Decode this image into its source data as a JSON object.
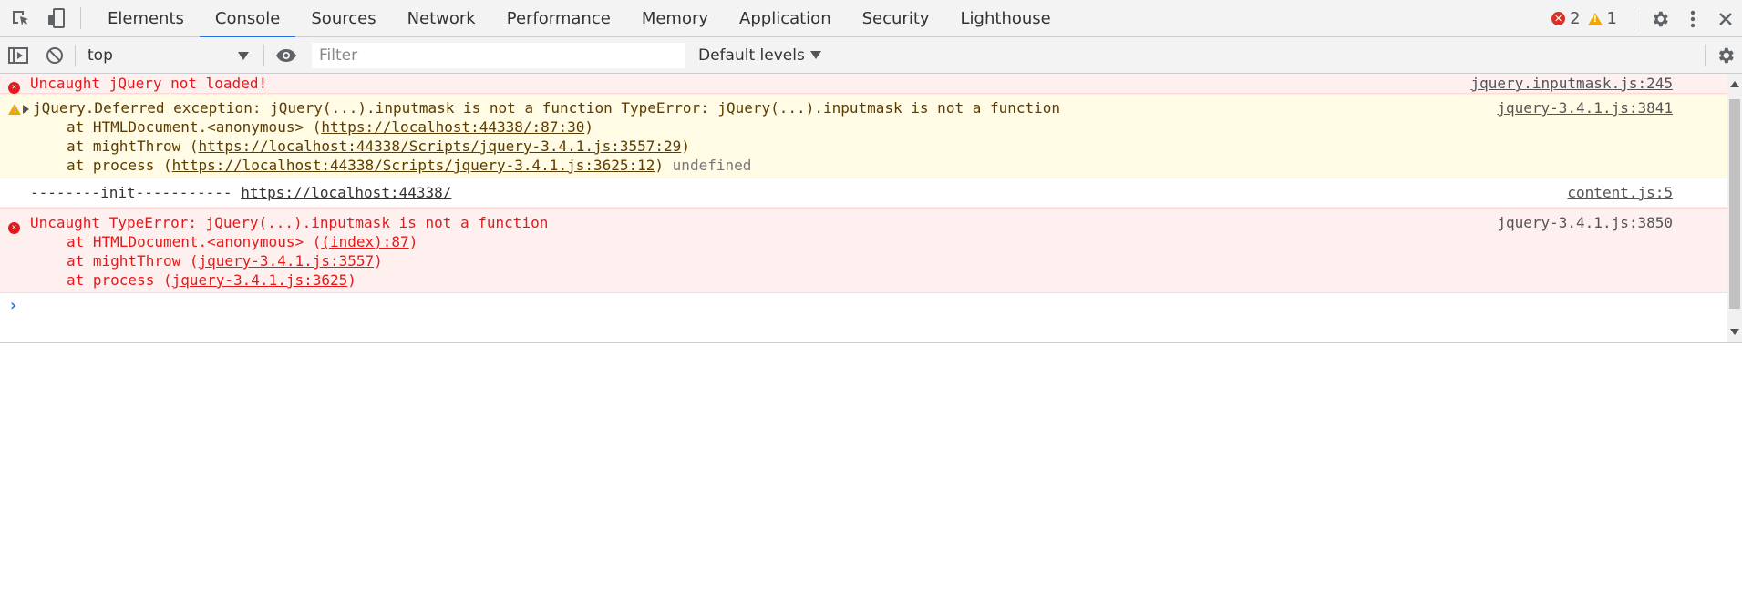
{
  "tabs": [
    "Elements",
    "Console",
    "Sources",
    "Network",
    "Performance",
    "Memory",
    "Application",
    "Security",
    "Lighthouse"
  ],
  "active_tab": "Console",
  "counters": {
    "errors": "2",
    "warnings": "1"
  },
  "toolbar": {
    "context": "top",
    "filter_placeholder": "Filter",
    "levels": "Default levels"
  },
  "messages": [
    {
      "level": "error",
      "text": "Uncaught jQuery not loaded!",
      "source": "jquery.inputmask.js:245"
    },
    {
      "level": "warning",
      "text": "jQuery.Deferred exception: jQuery(...).inputmask is not a function TypeError: jQuery(...).inputmask is not a function",
      "source": "jquery-3.4.1.js:3841",
      "stack": [
        {
          "prefix": "at HTMLDocument.<anonymous> (",
          "link": "https://localhost:44338/:87:30",
          "suffix": ")"
        },
        {
          "prefix": "at mightThrow (",
          "link": "https://localhost:44338/Scripts/jquery-3.4.1.js:3557:29",
          "suffix": ")"
        },
        {
          "prefix": "at process (",
          "link": "https://localhost:44338/Scripts/jquery-3.4.1.js:3625:12",
          "suffix": ") ",
          "extra": "undefined"
        }
      ]
    },
    {
      "level": "log",
      "text": "--------init----------- ",
      "link": "https://localhost:44338/",
      "source": "content.js:5"
    },
    {
      "level": "error",
      "text": "Uncaught TypeError: jQuery(...).inputmask is not a function",
      "source": "jquery-3.4.1.js:3850",
      "stack": [
        {
          "prefix": "at HTMLDocument.<anonymous> (",
          "link": "(index):87",
          "suffix": ")"
        },
        {
          "prefix": "at mightThrow (",
          "link": "jquery-3.4.1.js:3557",
          "suffix": ")"
        },
        {
          "prefix": "at process (",
          "link": "jquery-3.4.1.js:3625",
          "suffix": ")"
        }
      ]
    }
  ],
  "prompt_symbol": "›"
}
